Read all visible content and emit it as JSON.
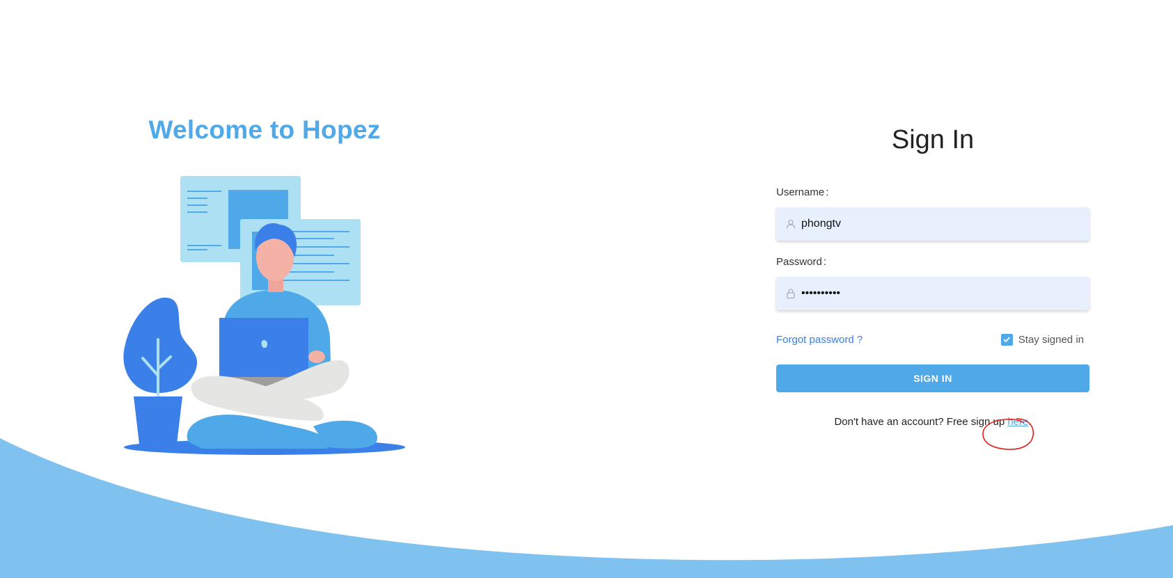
{
  "welcome": {
    "title": "Welcome to Hopez"
  },
  "signin": {
    "title": "Sign In",
    "username": {
      "label": "Username",
      "value": "phongtv",
      "icon": "user-icon"
    },
    "password": {
      "label": "Password",
      "value": "••••••••••",
      "icon": "lock-icon"
    },
    "forgot_label": "Forgot password ?",
    "stay_signed_in": {
      "label": "Stay signed in",
      "checked": true
    },
    "button_label": "SIGN IN",
    "signup": {
      "prefix": "Don't have an account? Free sign up ",
      "link": "here",
      "suffix": "."
    }
  },
  "colors": {
    "accent": "#4fa8e8",
    "link": "#3a7ee0",
    "input_bg": "#e8f0fe",
    "wave": "#80c2ef",
    "annotation": "#e0201b"
  }
}
